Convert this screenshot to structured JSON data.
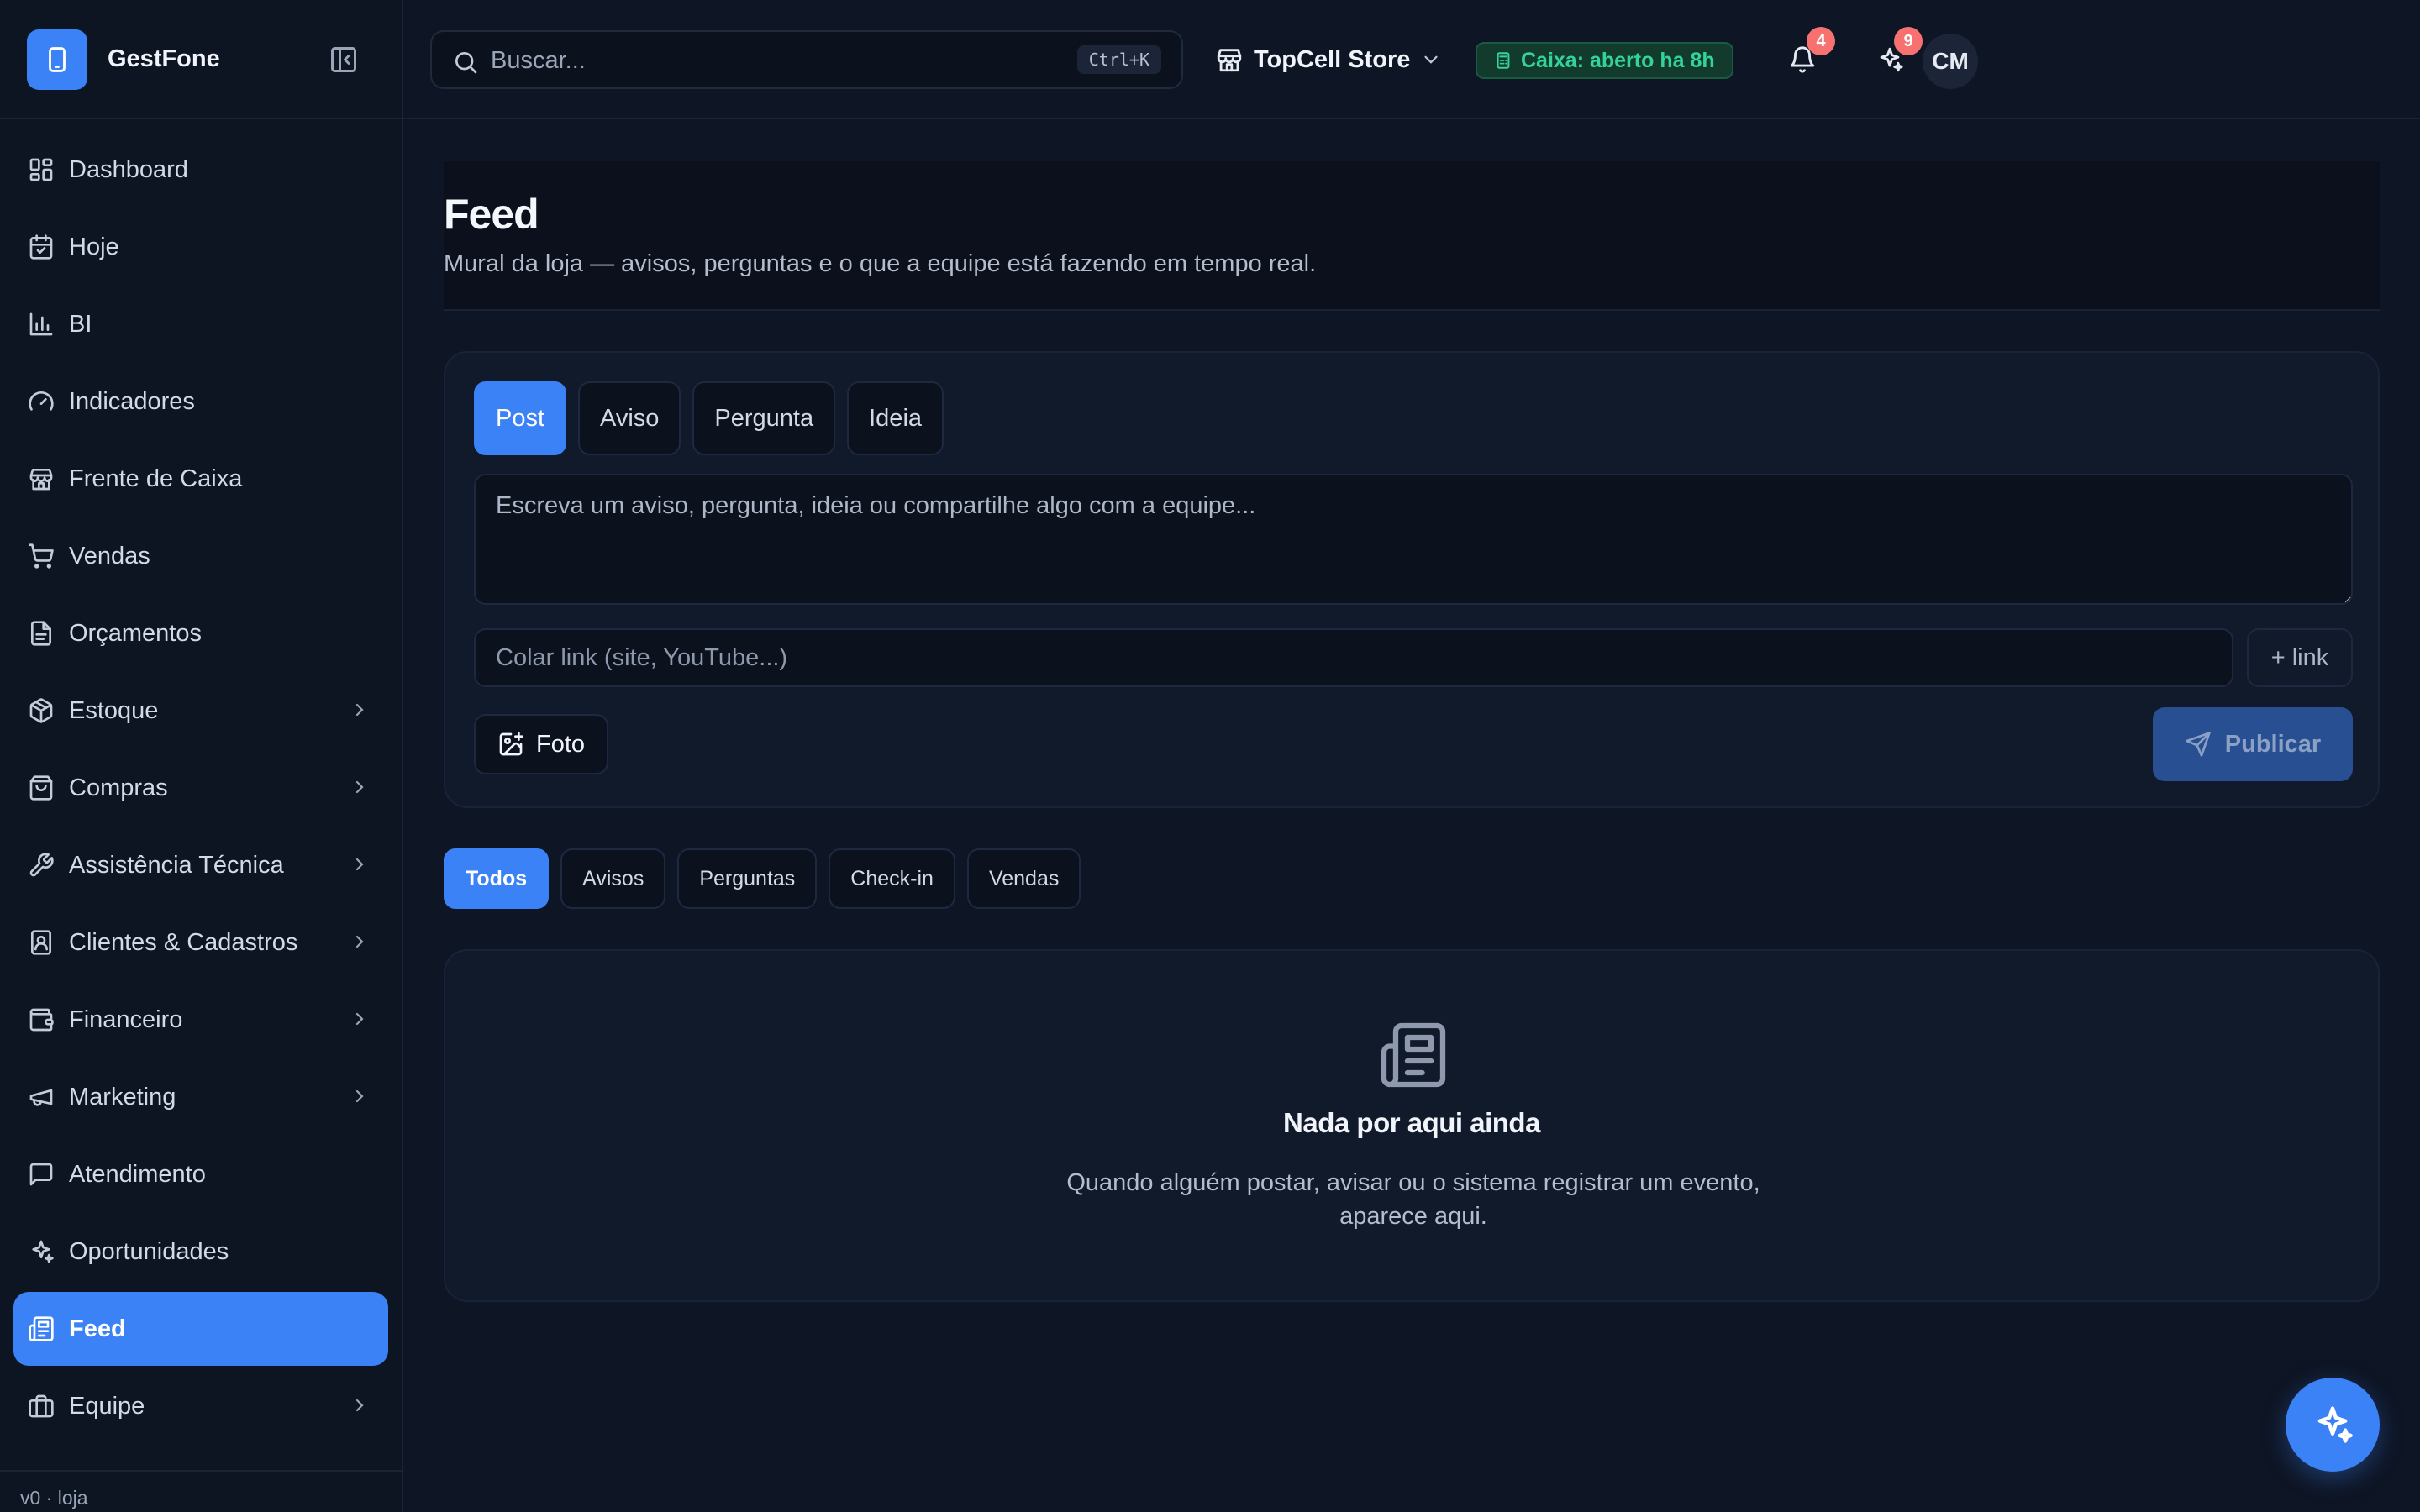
{
  "brand": {
    "name": "GestFone"
  },
  "sidebar": {
    "items": [
      {
        "label": "Dashboard",
        "icon": "dashboard-icon",
        "chevron": false
      },
      {
        "label": "Hoje",
        "icon": "calendar-icon",
        "chevron": false
      },
      {
        "label": "BI",
        "icon": "bar-chart-icon",
        "chevron": false
      },
      {
        "label": "Indicadores",
        "icon": "gauge-icon",
        "chevron": false
      },
      {
        "label": "Frente de Caixa",
        "icon": "store-icon",
        "chevron": false
      },
      {
        "label": "Vendas",
        "icon": "cart-icon",
        "chevron": false
      },
      {
        "label": "Orçamentos",
        "icon": "document-icon",
        "chevron": false
      },
      {
        "label": "Estoque",
        "icon": "package-icon",
        "chevron": true
      },
      {
        "label": "Compras",
        "icon": "shopping-bag-icon",
        "chevron": true
      },
      {
        "label": "Assistência Técnica",
        "icon": "wrench-icon",
        "chevron": true
      },
      {
        "label": "Clientes & Cadastros",
        "icon": "contact-icon",
        "chevron": true
      },
      {
        "label": "Financeiro",
        "icon": "wallet-icon",
        "chevron": true
      },
      {
        "label": "Marketing",
        "icon": "megaphone-icon",
        "chevron": true
      },
      {
        "label": "Atendimento",
        "icon": "chat-icon",
        "chevron": false
      },
      {
        "label": "Oportunidades",
        "icon": "sparkles-icon",
        "chevron": false
      },
      {
        "label": "Feed",
        "icon": "newspaper-icon",
        "chevron": false,
        "active": true
      },
      {
        "label": "Equipe",
        "icon": "briefcase-icon",
        "chevron": true
      }
    ],
    "footer": "v0 · loja"
  },
  "header": {
    "search_placeholder": "Buscar...",
    "search_shortcut": "Ctrl+K",
    "store_name": "TopCell Store",
    "caixa_status": "Caixa: aberto ha 8h",
    "notifications_count": "4",
    "ai_count": "9",
    "avatar_initials": "CM"
  },
  "page": {
    "title": "Feed",
    "subtitle": "Mural da loja — avisos, perguntas e o que a equipe está fazendo em tempo real."
  },
  "composer": {
    "tabs": [
      "Post",
      "Aviso",
      "Pergunta",
      "Ideia"
    ],
    "active_tab": "Post",
    "text_placeholder": "Escreva um aviso, pergunta, ideia ou compartilhe algo com a equipe...",
    "link_placeholder": "Colar link (site, YouTube...)",
    "add_link_label": "+ link",
    "photo_label": "Foto",
    "publish_label": "Publicar"
  },
  "filters": {
    "tabs": [
      "Todos",
      "Avisos",
      "Perguntas",
      "Check-in",
      "Vendas"
    ],
    "active": "Todos"
  },
  "empty_state": {
    "title": "Nada por aqui ainda",
    "description": "Quando alguém postar, avisar ou o sistema registrar um evento, aparece aqui."
  },
  "colors": {
    "accent": "#3b82f6",
    "background": "#0e1524",
    "success": "#34d399",
    "badge": "#f87171"
  }
}
